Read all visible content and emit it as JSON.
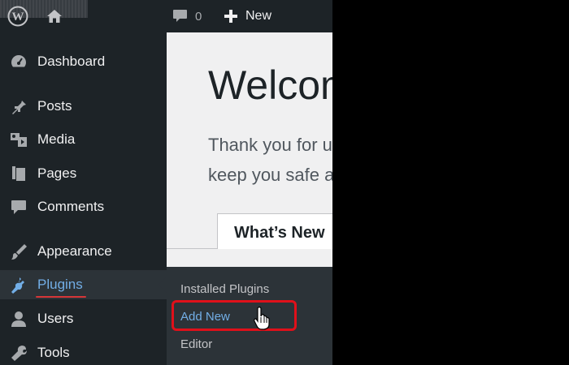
{
  "adminbar": {
    "comments_count": "0",
    "new_label": "New"
  },
  "sidebar": {
    "items": [
      {
        "label": "Dashboard",
        "icon": "dashboard-icon"
      },
      {
        "label": "Posts",
        "icon": "pushpin-icon"
      },
      {
        "label": "Media",
        "icon": "media-icon"
      },
      {
        "label": "Pages",
        "icon": "pages-icon"
      },
      {
        "label": "Comments",
        "icon": "comment-bubble-icon"
      },
      {
        "label": "Appearance",
        "icon": "paintbrush-icon"
      },
      {
        "label": "Plugins",
        "icon": "plugin-icon",
        "active": true
      },
      {
        "label": "Users",
        "icon": "user-icon"
      },
      {
        "label": "Tools",
        "icon": "wrench-icon"
      }
    ],
    "plugins_submenu": [
      {
        "label": "Installed Plugins"
      },
      {
        "label": "Add New",
        "current": true
      },
      {
        "label": "Editor"
      }
    ]
  },
  "main": {
    "welcome_title": "Welcome to WordPress!",
    "welcome_text_line1": "Thank you for updating to the latest version!",
    "welcome_text_line2": "keep you safe and secure.",
    "tab_label": "What’s New"
  },
  "colors": {
    "admin_dark": "#1d2327",
    "submenu_bg": "#2c3338",
    "active_blue": "#72aee6",
    "annotation_red": "#e0101a"
  }
}
